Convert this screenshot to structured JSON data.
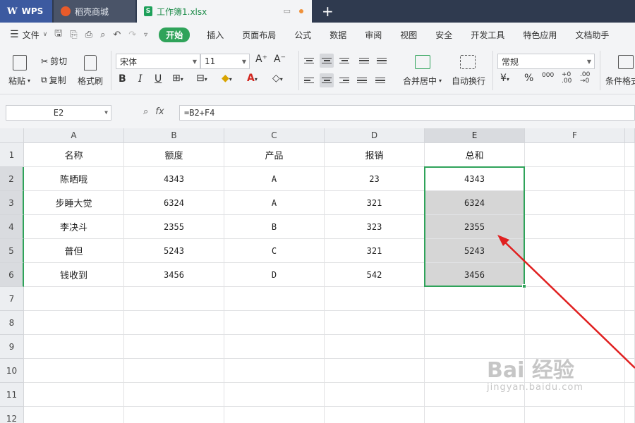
{
  "titlebar": {
    "tabs": [
      {
        "label": "WPS"
      },
      {
        "label": "稻壳商城"
      },
      {
        "label": "工作簿1.xlsx"
      }
    ],
    "new_tab": "+"
  },
  "menubar": {
    "file": "文件",
    "items": [
      "开始",
      "插入",
      "页面布局",
      "公式",
      "数据",
      "审阅",
      "视图",
      "安全",
      "开发工具",
      "特色应用",
      "文档助手"
    ],
    "active": "开始"
  },
  "ribbon": {
    "paste": "粘贴",
    "cut": "剪切",
    "copy": "复制",
    "format_painter": "格式刷",
    "font_name": "宋体",
    "font_size": "11",
    "merge_center": "合并居中",
    "wrap_text": "自动换行",
    "number_format": "常规",
    "conditional_format": "条件格式",
    "bold": "B",
    "italic": "I",
    "underline": "U",
    "percent": "%",
    "thousands": "000"
  },
  "formulabar": {
    "name_box": "E2",
    "fx": "fx",
    "formula": "=B2+F4"
  },
  "sheet": {
    "columns": [
      "A",
      "B",
      "C",
      "D",
      "E",
      "F"
    ],
    "rows": [
      "1",
      "2",
      "3",
      "4",
      "5",
      "6",
      "7",
      "8",
      "9",
      "10",
      "11",
      "12"
    ],
    "cells": [
      [
        "名称",
        "额度",
        "产品",
        "报销",
        "总和",
        ""
      ],
      [
        "陈晒哦",
        "4343",
        "A",
        "23",
        "4343",
        ""
      ],
      [
        "步睡大觉",
        "6324",
        "A",
        "321",
        "6324",
        ""
      ],
      [
        "李决斗",
        "2355",
        "B",
        "323",
        "2355",
        ""
      ],
      [
        "普但",
        "5243",
        "C",
        "321",
        "5243",
        ""
      ],
      [
        "钱收到",
        "3456",
        "D",
        "542",
        "3456",
        ""
      ]
    ],
    "selected_column": "E",
    "selected_range": "E2:E6"
  },
  "watermark": {
    "main": "Bai 经验",
    "sub": "jingyan.baidu.com"
  },
  "colors": {
    "accent_green": "#2fa35a",
    "arrow_red": "#e02020"
  }
}
